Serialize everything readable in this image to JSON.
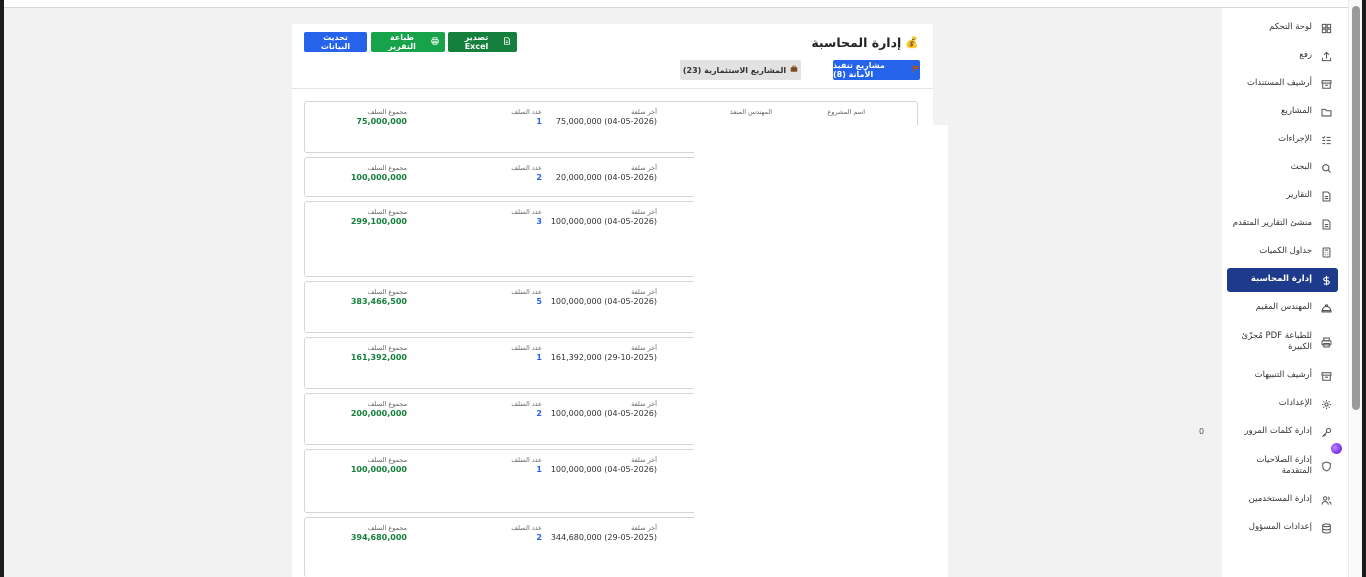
{
  "sidebar": {
    "items": [
      {
        "label": "لوحة التحكم",
        "icon": "dashboard-icon"
      },
      {
        "label": "رفع",
        "icon": "upload-icon"
      },
      {
        "label": "أرشيف المستندات",
        "icon": "archive-icon"
      },
      {
        "label": "المشاريع",
        "icon": "folder-icon"
      },
      {
        "label": "الإجراءات",
        "icon": "list-check-icon"
      },
      {
        "label": "البحث",
        "icon": "search-icon"
      },
      {
        "label": "التقارير",
        "icon": "file-text-icon"
      },
      {
        "label": "منشئ التقارير المتقدم",
        "icon": "file-text-icon"
      },
      {
        "label": "جداول الكميات",
        "icon": "calculator-icon"
      },
      {
        "label": "إدارة المحاسبة",
        "icon": "dollar-icon",
        "active": true
      },
      {
        "label": "المهندس المقيم",
        "icon": "hard-hat-icon"
      },
      {
        "label": "مُجزّئ PDF للطباعة الكبيرة",
        "icon": "printer-icon"
      },
      {
        "label": "أرشيف التنبيهات",
        "icon": "archive-icon"
      },
      {
        "label": "الإعدادات",
        "icon": "gear-icon"
      },
      {
        "label": "إدارة كلمات المرور",
        "icon": "key-icon",
        "badge": "0"
      },
      {
        "label": "إدارة الصلاحيات المتقدمة",
        "icon": "shield-icon"
      },
      {
        "label": "إدارة المستخدمين",
        "icon": "users-icon"
      },
      {
        "label": "إعدادات المسؤول",
        "icon": "database-icon"
      }
    ]
  },
  "header": {
    "title": "إدارة المحاسبة",
    "title_icon": "💰",
    "buttons": {
      "refresh": "تحديث البيانات",
      "print": "طباعة التقرير",
      "excel": "تصدير Excel"
    },
    "tabs": {
      "active": "مشاريع تنفيذ الأمانة (8)",
      "inactive": "المشاريع الاستثمارية (23)"
    }
  },
  "labels": {
    "total": "مجموع السلف",
    "count": "عدد السلف",
    "last": "آخر سلفة",
    "engineer": "المهندس المنفذ",
    "project": "اسم المشروع"
  },
  "cards": [
    {
      "total": "75,000,000",
      "count": "1",
      "last": "75,000,000 (04-05-2026)"
    },
    {
      "total": "100,000,000",
      "count": "2",
      "last": "20,000,000 (04-05-2026)"
    },
    {
      "total": "299,100,000",
      "count": "3",
      "last": "100,000,000 (04-05-2026)"
    },
    {
      "total": "383,466,500",
      "count": "5",
      "last": "100,000,000 (04-05-2026)"
    },
    {
      "total": "161,392,000",
      "count": "1",
      "last": "161,392,000 (29-10-2025)"
    },
    {
      "total": "200,000,000",
      "count": "2",
      "last": "100,000,000 (04-05-2026)"
    },
    {
      "total": "100,000,000",
      "count": "1",
      "last": "100,000,000 (04-05-2026)"
    },
    {
      "total": "394,680,000",
      "count": "2",
      "last": "344,680,000 (29-05-2025)"
    }
  ],
  "colors": {
    "active_nav": "#1e3a8a",
    "primary": "#2563eb",
    "success": "#16a34a",
    "total_green": "#15803d"
  }
}
